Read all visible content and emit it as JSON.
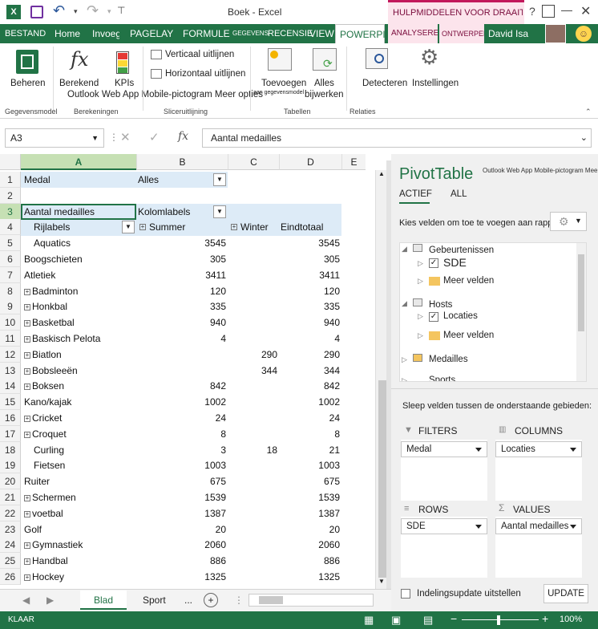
{
  "title": "Boek - Excel",
  "contextual_tab": "HULPMIDDELEN VOOR DRAAITABEL",
  "tabs": [
    "BESTAND",
    "Home",
    "Invoegen",
    "PAGELAY",
    "FORMULE",
    "GEGEVENS",
    "RECENSIE",
    "VIEW",
    "POWERPI",
    "ANALYSEREN",
    "ONTWERPEN"
  ],
  "user": "David Isa",
  "ribbon": {
    "beheren": "Beheren",
    "berekend": "Berekend",
    "kpis": "KPIs",
    "verticaal": "Verticaal uitlijnen",
    "horizontaal": "Horizontaal uitlijnen",
    "toevoegen": "Toevoegen",
    "toevoegen_sub": "aan gegevensmodel",
    "alles": "Alles",
    "bijwerken": "bijwerken",
    "detecteren": "Detecteren",
    "instellingen": "Instellingen",
    "overlay": "Outlook Web App Mobile-pictogram Meer opties",
    "groups": [
      "Gegevensmodel",
      "Berekeningen",
      "Slicer­uitlijning",
      "Tabellen",
      "Relaties"
    ]
  },
  "namebox": "A3",
  "formula": "Aantal medailles",
  "columns": [
    "A",
    "B",
    "C",
    "D",
    "E"
  ],
  "rows": [
    {
      "n": "1",
      "a": "Medal",
      "b": "Alles",
      "c": "",
      "d": ""
    },
    {
      "n": "2",
      "a": "",
      "b": "",
      "c": "",
      "d": ""
    },
    {
      "n": "3",
      "a": "Aantal medailles",
      "b": "Kolomlabels",
      "c": "",
      "d": ""
    },
    {
      "n": "4",
      "a": "Rijlabels",
      "b": "Summer",
      "c": "Winter",
      "d": "Eindtotaal"
    },
    {
      "n": "5",
      "a": "Aquatics",
      "b": "3545",
      "c": "",
      "d": "3545"
    },
    {
      "n": "6",
      "a": "Boogschieten",
      "b": "305",
      "c": "",
      "d": "305"
    },
    {
      "n": "7",
      "a": "Atletiek",
      "b": "3411",
      "c": "",
      "d": "3411"
    },
    {
      "n": "8",
      "a": "Badminton",
      "b": "120",
      "c": "",
      "d": "120"
    },
    {
      "n": "9",
      "a": "Honkbal",
      "b": "335",
      "c": "",
      "d": "335"
    },
    {
      "n": "10",
      "a": "Basketbal",
      "b": "940",
      "c": "",
      "d": "940"
    },
    {
      "n": "11",
      "a": "Baskisch Pelota",
      "b": "4",
      "c": "",
      "d": "4"
    },
    {
      "n": "12",
      "a": "Biatlon",
      "b": "",
      "c": "290",
      "d": "290"
    },
    {
      "n": "13",
      "a": "Bobsleeën",
      "b": "",
      "c": "344",
      "d": "344"
    },
    {
      "n": "14",
      "a": "Boksen",
      "b": "842",
      "c": "",
      "d": "842"
    },
    {
      "n": "15",
      "a": "Kano/kajak",
      "b": "1002",
      "c": "",
      "d": "1002"
    },
    {
      "n": "16",
      "a": "Cricket",
      "b": "24",
      "c": "",
      "d": "24"
    },
    {
      "n": "17",
      "a": "Croquet",
      "b": "8",
      "c": "",
      "d": "8"
    },
    {
      "n": "18",
      "a": "Curling",
      "b": "3",
      "c": "18",
      "d": "21"
    },
    {
      "n": "19",
      "a": "Fietsen",
      "b": "1003",
      "c": "",
      "d": "1003"
    },
    {
      "n": "20",
      "a": "Ruiter",
      "b": "675",
      "c": "",
      "d": "675"
    },
    {
      "n": "21",
      "a": "Schermen",
      "b": "1539",
      "c": "",
      "d": "1539"
    },
    {
      "n": "22",
      "a": "voetbal",
      "b": "1387",
      "c": "",
      "d": "1387"
    },
    {
      "n": "23",
      "a": "Golf",
      "b": "20",
      "c": "",
      "d": "20"
    },
    {
      "n": "24",
      "a": "Gymnastiek",
      "b": "2060",
      "c": "",
      "d": "2060"
    },
    {
      "n": "25",
      "a": "Handbal",
      "b": "886",
      "c": "",
      "d": "886"
    },
    {
      "n": "26",
      "a": "Hockey",
      "b": "1325",
      "c": "",
      "d": "1325"
    }
  ],
  "sheets": {
    "active": "Blad",
    "other": "Sport",
    "more": "..."
  },
  "pane": {
    "title": "PivotTable",
    "overlay": "Outlook Web App Mobile-pictogram Meer opties",
    "tab_active": "ACTIEF",
    "tab_all": "ALL",
    "choose": "Kies velden om toe te voegen aan rapport:",
    "tree": {
      "gebeurtenissen": "Gebeurtenissen",
      "sde": "SDE",
      "meer1": "Meer velden",
      "hosts": "Hosts",
      "locaties": "Locaties",
      "meer2": "Meer velden",
      "medailles": "Medailles",
      "sports": "Sports"
    },
    "drag": "Sleep velden tussen de onderstaande gebieden:",
    "filters": "FILTERS",
    "columns": "COLUMNS",
    "rows": "ROWS",
    "values": "VALUES",
    "filter_field": "Medal",
    "column_field": "Locaties",
    "row_field": "SDE",
    "value_field": "Aantal medailles",
    "defer": "Indelingsupdate uitstellen",
    "update": "UPDATE"
  },
  "status": {
    "ready": "KLAAR",
    "zoom": "100%"
  },
  "colors": {
    "excel_green": "#217346",
    "pivot_header": "#ddebf7",
    "selected_col": "#c6e0b4"
  }
}
